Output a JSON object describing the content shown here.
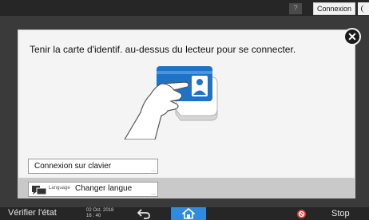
{
  "topbar": {
    "help_label": "?",
    "login_label": "Connexion"
  },
  "dialog": {
    "instruction": "Tenir la carte d'identif. au-dessus du lecteur pour se connecter.",
    "keyboard_login_label": "Connexion sur clavier",
    "language_small_label": "Language",
    "change_language_label": "Changer langue",
    "more_indicator": "..."
  },
  "bottombar": {
    "check_status_label": "Vérifier l'état",
    "date": "02 Oct. 2018",
    "time": "16 : 40",
    "stop_label": "Stop"
  },
  "icons": {
    "help": "help-icon",
    "moon": "moon-icon",
    "close": "close-icon",
    "language": "language-icon",
    "back": "back-arrow-icon",
    "home": "home-icon",
    "stop": "stop-icon"
  },
  "colors": {
    "accent_home": "#2f8be0",
    "stop_red": "#e53935",
    "card_blue": "#1e73c8"
  }
}
